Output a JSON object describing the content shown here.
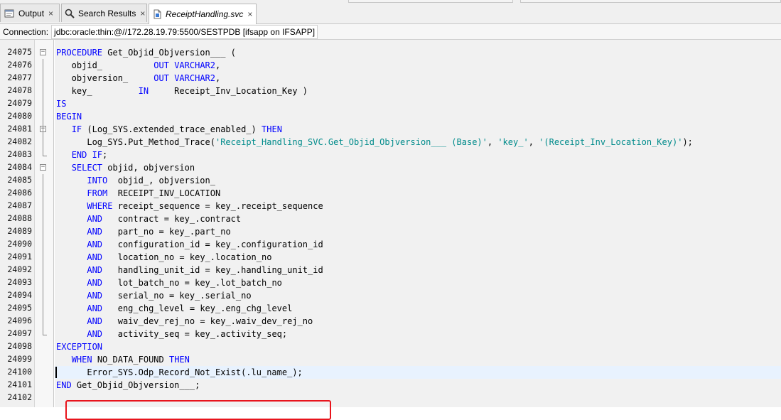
{
  "tabs": [
    {
      "label": "Output",
      "icon": "output-icon",
      "close": "×"
    },
    {
      "label": "Search Results",
      "icon": "search-icon",
      "close": "×"
    },
    {
      "label": "ReceiptHandling.svc",
      "icon": "file-icon",
      "close": "×"
    }
  ],
  "connection": {
    "label": "Connection:",
    "value": "jdbc:oracle:thin:@//172.28.19.79:5500/SESTPDB [ifsapp on IFSAPP]"
  },
  "editor": {
    "current_line": "24100",
    "lines": [
      {
        "n": "24075"
      },
      {
        "n": "24076"
      },
      {
        "n": "24077"
      },
      {
        "n": "24078"
      },
      {
        "n": "24079"
      },
      {
        "n": "24080"
      },
      {
        "n": "24081"
      },
      {
        "n": "24082"
      },
      {
        "n": "24083"
      },
      {
        "n": "24084"
      },
      {
        "n": "24085"
      },
      {
        "n": "24086"
      },
      {
        "n": "24087"
      },
      {
        "n": "24088"
      },
      {
        "n": "24089"
      },
      {
        "n": "24090"
      },
      {
        "n": "24091"
      },
      {
        "n": "24092"
      },
      {
        "n": "24093"
      },
      {
        "n": "24094"
      },
      {
        "n": "24095"
      },
      {
        "n": "24096"
      },
      {
        "n": "24097"
      },
      {
        "n": "24098"
      },
      {
        "n": "24099"
      },
      {
        "n": "24100"
      },
      {
        "n": "24101"
      },
      {
        "n": "24102"
      }
    ],
    "code": [
      [
        [
          "kw",
          "PROCEDURE"
        ],
        [
          "t",
          " Get_Objid_Objversion___ ("
        ]
      ],
      [
        [
          "t",
          "   objid_          "
        ],
        [
          "kw",
          "OUT"
        ],
        [
          "t",
          " "
        ],
        [
          "kw",
          "VARCHAR2"
        ],
        [
          "t",
          ","
        ]
      ],
      [
        [
          "t",
          "   objversion_     "
        ],
        [
          "kw",
          "OUT"
        ],
        [
          "t",
          " "
        ],
        [
          "kw",
          "VARCHAR2"
        ],
        [
          "t",
          ","
        ]
      ],
      [
        [
          "t",
          "   key_         "
        ],
        [
          "kw",
          "IN"
        ],
        [
          "t",
          "     Receipt_Inv_Location_Key )"
        ]
      ],
      [
        [
          "kw",
          "IS"
        ]
      ],
      [
        [
          "kw",
          "BEGIN"
        ]
      ],
      [
        [
          "t",
          "   "
        ],
        [
          "kw",
          "IF"
        ],
        [
          "t",
          " (Log_SYS.extended_trace_enabled_) "
        ],
        [
          "kw",
          "THEN"
        ]
      ],
      [
        [
          "t",
          "      Log_SYS.Put_Method_Trace("
        ],
        [
          "str",
          "'Receipt_Handling_SVC.Get_Objid_Objversion___ (Base)'"
        ],
        [
          "t",
          ", "
        ],
        [
          "str",
          "'key_'"
        ],
        [
          "t",
          ", "
        ],
        [
          "str",
          "'(Receipt_Inv_Location_Key)'"
        ],
        [
          "t",
          ");"
        ]
      ],
      [
        [
          "t",
          "   "
        ],
        [
          "kw",
          "END IF"
        ],
        [
          "t",
          ";"
        ]
      ],
      [
        [
          "t",
          "   "
        ],
        [
          "kw",
          "SELECT"
        ],
        [
          "t",
          " objid, objversion"
        ]
      ],
      [
        [
          "t",
          "      "
        ],
        [
          "kw",
          "INTO"
        ],
        [
          "t",
          "  objid_, objversion_"
        ]
      ],
      [
        [
          "t",
          "      "
        ],
        [
          "kw",
          "FROM"
        ],
        [
          "t",
          "  RECEIPT_INV_LOCATION"
        ]
      ],
      [
        [
          "t",
          "      "
        ],
        [
          "kw",
          "WHERE"
        ],
        [
          "t",
          " receipt_sequence = key_.receipt_sequence"
        ]
      ],
      [
        [
          "t",
          "      "
        ],
        [
          "kw",
          "AND"
        ],
        [
          "t",
          "   contract = key_.contract"
        ]
      ],
      [
        [
          "t",
          "      "
        ],
        [
          "kw",
          "AND"
        ],
        [
          "t",
          "   part_no = key_.part_no"
        ]
      ],
      [
        [
          "t",
          "      "
        ],
        [
          "kw",
          "AND"
        ],
        [
          "t",
          "   configuration_id = key_.configuration_id"
        ]
      ],
      [
        [
          "t",
          "      "
        ],
        [
          "kw",
          "AND"
        ],
        [
          "t",
          "   location_no = key_.location_no"
        ]
      ],
      [
        [
          "t",
          "      "
        ],
        [
          "kw",
          "AND"
        ],
        [
          "t",
          "   handling_unit_id = key_.handling_unit_id"
        ]
      ],
      [
        [
          "t",
          "      "
        ],
        [
          "kw",
          "AND"
        ],
        [
          "t",
          "   lot_batch_no = key_.lot_batch_no"
        ]
      ],
      [
        [
          "t",
          "      "
        ],
        [
          "kw",
          "AND"
        ],
        [
          "t",
          "   serial_no = key_.serial_no"
        ]
      ],
      [
        [
          "t",
          "      "
        ],
        [
          "kw",
          "AND"
        ],
        [
          "t",
          "   eng_chg_level = key_.eng_chg_level"
        ]
      ],
      [
        [
          "t",
          "      "
        ],
        [
          "kw",
          "AND"
        ],
        [
          "t",
          "   waiv_dev_rej_no = key_.waiv_dev_rej_no"
        ]
      ],
      [
        [
          "t",
          "      "
        ],
        [
          "kw",
          "AND"
        ],
        [
          "t",
          "   activity_seq = key_.activity_seq;"
        ]
      ],
      [
        [
          "kw",
          "EXCEPTION"
        ]
      ],
      [
        [
          "t",
          "   "
        ],
        [
          "kw",
          "WHEN"
        ],
        [
          "t",
          " NO_DATA_FOUND "
        ],
        [
          "kw",
          "THEN"
        ]
      ],
      [
        [
          "t",
          "      Error_SYS.Odp_Record_Not_Exist(.lu_name_);"
        ]
      ],
      [
        [
          "kw",
          "END"
        ],
        [
          "t",
          " Get_Objid_Objversion___;"
        ]
      ],
      [
        [
          "t",
          ""
        ]
      ]
    ]
  },
  "colors": {
    "keyword": "#0000ff",
    "string": "#008b8b",
    "highlight_box": "#e8141c",
    "current_line": "#e8f2fe"
  }
}
